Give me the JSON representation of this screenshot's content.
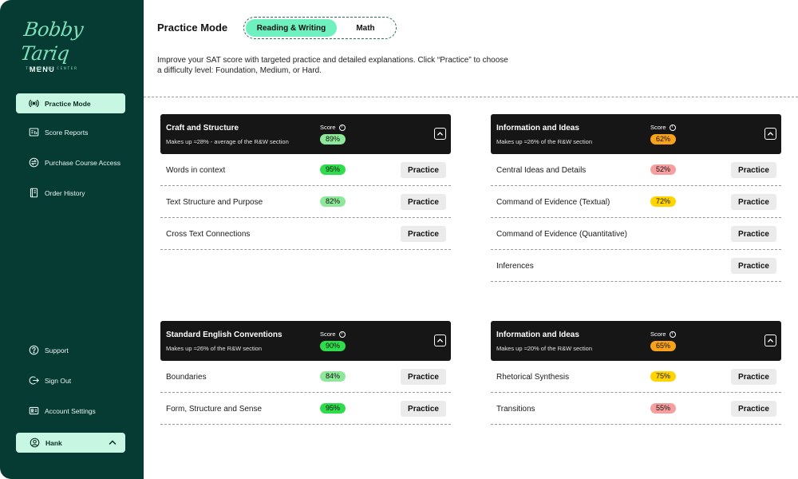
{
  "colors": {
    "sidebar_bg": "#063b33",
    "accent": "#6ef0bf",
    "active_nav_bg": "#c7f6e3",
    "header_dark": "#161616",
    "score_green": "#2fdc4b",
    "score_light_green": "#8ee89a",
    "score_orange": "#f7a21a",
    "score_yellow": "#ffd400",
    "score_pink": "#f79f9f"
  },
  "brand": {
    "name": "Bobby Tariq",
    "tagline": "TUTORING CENTER"
  },
  "sidebar": {
    "menu_label": "MENU",
    "items": [
      {
        "label": "Practice Mode",
        "icon": "broadcast-icon",
        "active": true
      },
      {
        "label": "Score Reports",
        "icon": "report-icon",
        "active": false
      },
      {
        "label": "Purchase Course Access",
        "icon": "exchange-icon",
        "active": false
      },
      {
        "label": "Order History",
        "icon": "notebook-icon",
        "active": false
      }
    ],
    "bottom_items": [
      {
        "label": "Support",
        "icon": "help-icon"
      },
      {
        "label": "Sign Out",
        "icon": "sign-out-icon"
      },
      {
        "label": "Account Settings",
        "icon": "id-card-icon"
      }
    ],
    "user": {
      "name": "Hank",
      "icon": "user-icon"
    }
  },
  "header": {
    "title": "Practice Mode",
    "tabs": [
      {
        "label": "Reading & Writing",
        "active": true
      },
      {
        "label": "Math",
        "active": false
      }
    ],
    "intro": "Improve your SAT score with targeted practice and detailed explanations. Click “Practice” to choose a difficulty level: Foundation, Medium, or Hard."
  },
  "practice_label": "Practice",
  "score_label": "Score",
  "sections": [
    {
      "title": "Craft and Structure",
      "subtitle": "Makes up ≈28% - average of the R&W section",
      "score": "89%",
      "score_color": "#8ee89a",
      "rows": [
        {
          "label": "Words in context",
          "score": "95%",
          "score_color": "#2fdc4b"
        },
        {
          "label": "Text Structure and Purpose",
          "score": "82%",
          "score_color": "#8ee89a"
        },
        {
          "label": "Cross Text Connections",
          "score": null,
          "score_color": null
        }
      ]
    },
    {
      "title": "Information and Ideas",
      "subtitle": "Makes up ≈26% of the R&W section",
      "score": "62%",
      "score_color": "#f7a21a",
      "rows": [
        {
          "label": "Central Ideas and Details",
          "score": "52%",
          "score_color": "#f79f9f"
        },
        {
          "label": "Command of Evidence (Textual)",
          "score": "72%",
          "score_color": "#ffd400"
        },
        {
          "label": "Command of Evidence (Quantitative)",
          "score": null,
          "score_color": null
        },
        {
          "label": "Inferences",
          "score": null,
          "score_color": null
        }
      ]
    },
    {
      "title": "Standard English Conventions",
      "subtitle": "Makes up ≈26% of the R&W section",
      "score": "90%",
      "score_color": "#2fdc4b",
      "rows": [
        {
          "label": "Boundaries",
          "score": "84%",
          "score_color": "#8ee89a"
        },
        {
          "label": "Form, Structure and Sense",
          "score": "95%",
          "score_color": "#2fdc4b"
        }
      ]
    },
    {
      "title": "Information and Ideas",
      "subtitle": "Makes up ≈20% of the R&W section",
      "score": "65%",
      "score_color": "#f7a21a",
      "rows": [
        {
          "label": "Rhetorical Synthesis",
          "score": "75%",
          "score_color": "#ffd400"
        },
        {
          "label": "Transitions",
          "score": "55%",
          "score_color": "#f79f9f"
        }
      ]
    }
  ]
}
